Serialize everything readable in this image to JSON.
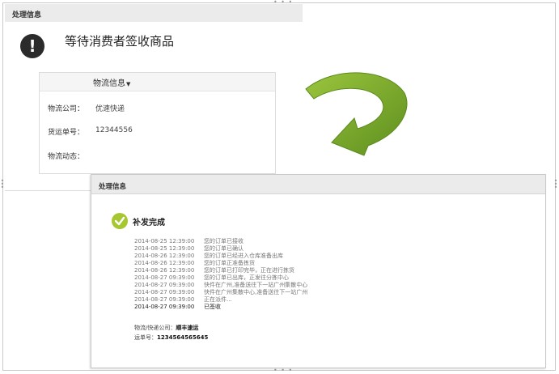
{
  "panel1": {
    "header": "处理信息",
    "status_title": "等待消费者签收商品",
    "status_icon": "exclamation-icon",
    "logistics": {
      "tab_label": "物流信息",
      "company_label": "物流公司：",
      "company_value": "优速快递",
      "waybill_label": "货运单号：",
      "waybill_value": "12344556",
      "dynamics_label": "物流动态："
    }
  },
  "arrow": {
    "color": "#7aa629",
    "icon": "curved-arrow-icon"
  },
  "panel2": {
    "header": "处理信息",
    "status_title": "补发完成",
    "status_icon": "check-icon",
    "status_color": "#a6c72f",
    "tracking": [
      {
        "time": "2014-08-25 12:39:00",
        "text": "您的订单已接收"
      },
      {
        "time": "2014-08-25 12:39:00",
        "text": "您的订单已确认"
      },
      {
        "time": "2014-08-26 12:39:00",
        "text": "您的订单已经进入仓库准备出库"
      },
      {
        "time": "2014-08-26 12:39:00",
        "text": "您的订单正准备拣货"
      },
      {
        "time": "2014-08-26 12:39:00",
        "text": "您的订单已打印完毕，正在进行拣货"
      },
      {
        "time": "2014-08-27 09:39:00",
        "text": "您的订单已出库，正发往分拣中心"
      },
      {
        "time": "2014-08-27 09:39:00",
        "text": "快件在广州,准备送往下一站广州集散中心"
      },
      {
        "time": "2014-08-27 09:39:00",
        "text": "快件在广州集散中心,准备送往下一站广州"
      },
      {
        "time": "2014-08-27 09:39:00",
        "text": "正在派件..."
      },
      {
        "time": "2014-08-27 09:39:00",
        "text": "已签收"
      }
    ],
    "carrier_label": "物流/快递公司：",
    "carrier_value": "顺丰速运",
    "waybill_label": "运单号：",
    "waybill_value": "1234564565645"
  }
}
